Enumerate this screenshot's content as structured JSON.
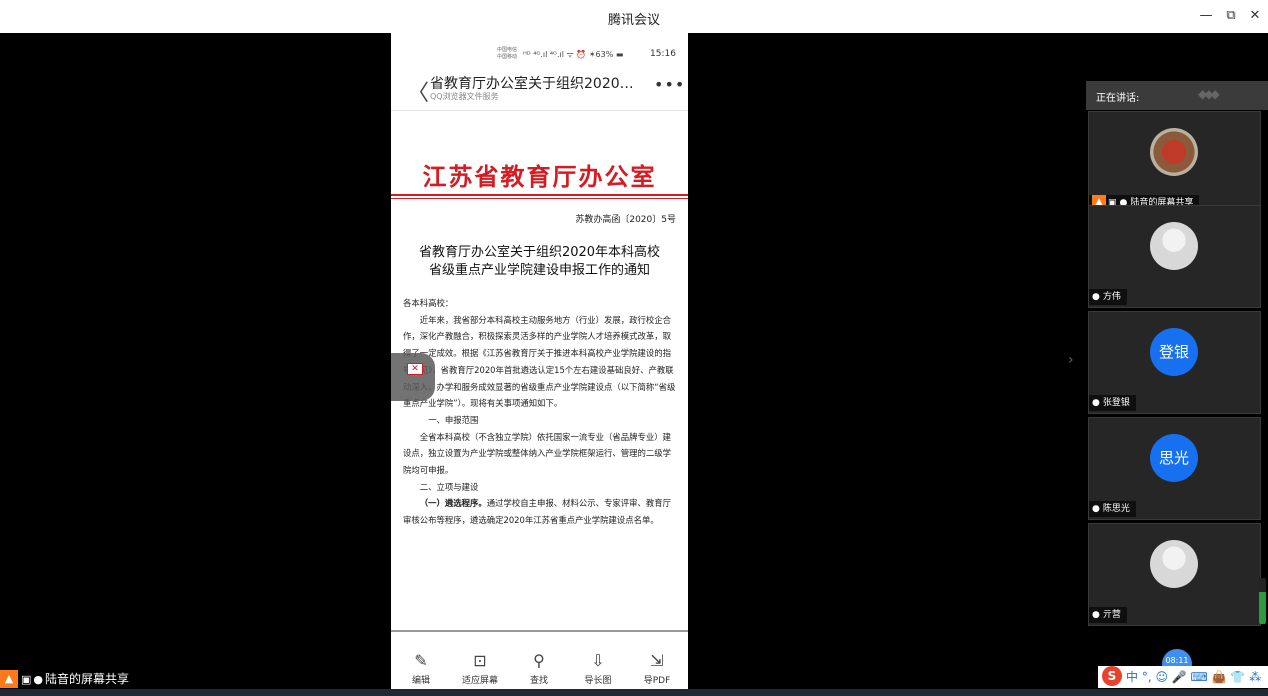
{
  "window": {
    "title": "腾讯会议",
    "minimize_glyph": "—",
    "restore_glyph": "⧉",
    "close_glyph": "✕"
  },
  "phone": {
    "statusbar": {
      "carrier1": "中国电信",
      "carrier2": "中国移动",
      "icons": "ᴴᴰ ⁴ᴳ.ıl ⁴ᴳ.ıl ᯤ  ⏰ ✶63% ▬",
      "time": "15:16"
    },
    "header": {
      "back_glyph": "〈",
      "title": "省教育厅办公室关于组织2020…",
      "subtitle": "QQ浏览器文件服务",
      "more_glyph": "•••"
    },
    "document": {
      "red_heading": "江苏省教育厅办公室",
      "doc_number": "苏教办高函〔2020〕5号",
      "title_line1": "省教育厅办公室关于组织2020年本科高校",
      "title_line2": "省级重点产业学院建设申报工作的通知",
      "salutation": "各本科高校：",
      "para1": "近年来，我省部分本科高校主动服务地方（行业）发展，政行校企合作，深化产教融合，积极探索灵活多样的产业学院人才培养模式改革，取得了一定成效。根据《江苏省教育厅关于推进本科高校产业学院建设的指导意见》，省教育厅2020年首批遴选认定15个左右建设基础良好、产教联动深入、办学和服务成效显著的省级重点产业学院建设点（以下简称“省级重点产业学院”）。现将有关事项通知如下。",
      "section1": "一、申报范围",
      "para2": "全省本科高校（不含独立学院）依托国家一流专业（省品牌专业）建设点，独立设置为产业学院或整体纳入产业学院框架运行、管理的二级学院均可申报。",
      "section2": "二、立项与建设",
      "para3_bold": "（一）遴选程序。",
      "para3": "通过学校自主申报、材料公示、专家评审、教育厅审核公布等程序，遴选确定2020年江苏省重点产业学院建设点名单。"
    },
    "float_icon": "✕",
    "toolbar": [
      {
        "icon": "✎",
        "label": "编辑"
      },
      {
        "icon": "⊡",
        "label": "适应屏幕"
      },
      {
        "icon": "⚲",
        "label": "查找"
      },
      {
        "icon": "⇩",
        "label": "导长图"
      },
      {
        "icon": "⇲",
        "label": "导PDF"
      }
    ]
  },
  "side_arrow": "›",
  "panel": {
    "speaking_label": "正在讲话:",
    "participants": [
      {
        "name": "陆音的屏幕共享",
        "avatar_text": "",
        "mic": "🎤",
        "extra": "👤🖥"
      },
      {
        "name": "方伟",
        "avatar_text": "",
        "mic": "🎤",
        "extra": ""
      },
      {
        "name": "张登银",
        "avatar_text": "登银",
        "mic": "🎤",
        "extra": ""
      },
      {
        "name": "陈思光",
        "avatar_text": "思光",
        "mic": "🎤",
        "extra": ""
      },
      {
        "name": "亓营",
        "avatar_text": "",
        "mic": "🎤",
        "extra": ""
      }
    ],
    "clock": "08:11"
  },
  "bottom": {
    "share_label": "陆音的屏幕共享",
    "share_person_icon": "👤",
    "share_screen_icon": "🖥",
    "share_mic_icon": "🎤"
  },
  "ime": {
    "logo": "S",
    "text": "中 °, ☺ 🎤 ⌨ 👜 👕 ⁂"
  },
  "colors": {
    "red_heading": "#d61c22",
    "avatar_blue": "#1670f0",
    "share_orange": "#ff7a1a"
  }
}
